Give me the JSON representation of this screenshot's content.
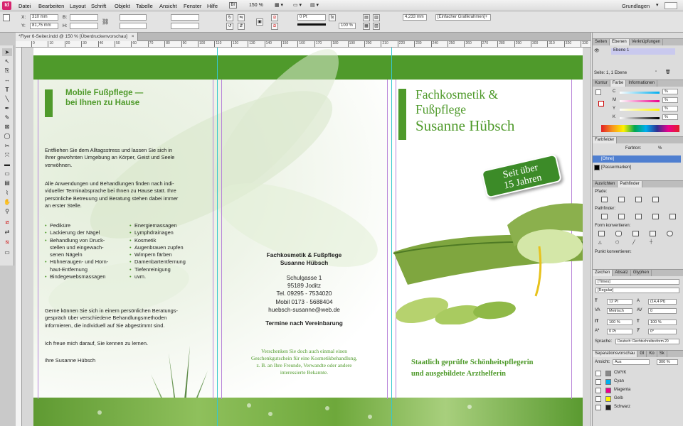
{
  "app": {
    "icon_label": "Id",
    "workspace": "Grundlagen",
    "zoom": "150 %"
  },
  "menu": [
    "Datei",
    "Bearbeiten",
    "Layout",
    "Schrift",
    "Objekt",
    "Tabelle",
    "Ansicht",
    "Fenster",
    "Hilfe"
  ],
  "control": {
    "x_label": "X:",
    "x_value": "310 mm",
    "y_label": "Y:",
    "y_value": "81,75 mm",
    "b_label": "B:",
    "h_label": "H:",
    "stroke_weight": "0 Pt",
    "scale": "100 %",
    "dimension": "4,233 mm",
    "frame_style": "[Einfacher Grafikrahmen]+"
  },
  "tab": {
    "title": "*Flyer 6-Seiter.indd @ 150 % [Überdruckenvorschau]"
  },
  "ruler_ticks": [
    "0",
    "10",
    "20",
    "30",
    "40",
    "50",
    "60",
    "70",
    "80",
    "90",
    "100",
    "110",
    "120",
    "130",
    "140",
    "150",
    "160",
    "170",
    "180",
    "190",
    "200",
    "210",
    "220",
    "230",
    "240",
    "250",
    "260",
    "270",
    "280",
    "290",
    "300",
    "310",
    "320",
    "330"
  ],
  "flyer": {
    "left": {
      "heading_line1": "Mobile Fußpflege —",
      "heading_line2": "bei Ihnen zu Hause",
      "p1": [
        "Entfliehen Sie dem Alltagsstress und lassen Sie sich in",
        "Ihrer gewohnten Umgebung an Körper, Geist und Seele",
        "verwöhnen."
      ],
      "p2": [
        "Alle Anwendungen und Behandlungen finden nach indi-",
        "vidueller Terminabsprache bei Ihnen zu Hause statt. Ihre",
        "persönliche Betreuung und Beratung stehen dabei immer",
        "an erster Stelle."
      ],
      "list_a": [
        "Pediküre",
        "Lackierung der Nägel",
        "Behandlung von Druck-",
        "Hühneraugen- und Horn-",
        "Bindegewebsmassagen"
      ],
      "list_a_cont": {
        "2": "stellen und eingewach-",
        "2b": "senen Nägeln",
        "3": "haut-Entfernung"
      },
      "list_b": [
        "Energiemassagen",
        "Lymphdrainagen",
        "Kosmetik",
        "Augenbrauen zupfen",
        "Wimpern färben",
        "Damenbartentfernung",
        "Tiefenreinigung",
        "uvm."
      ],
      "p3": [
        "Gerne können Sie sich in einem persönlichen Beratungs-",
        "gespräch über verschiedene Behandlungsmethoden",
        "informieren, die individuell auf Sie abgestimmt sind."
      ],
      "p4": "Ich freue mich darauf, Sie kennen zu lernen.",
      "signoff": "Ihre Susanne Hübsch"
    },
    "middle": {
      "name1": "Fachkosmetik & Fußpflege",
      "name2": "Susanne Hübsch",
      "address": [
        "Schulgasse 1",
        "95189 Joditz",
        "Tel. 09295 - 7534020",
        "Mobil 0173 - 5688404",
        "huebsch-susanne@web.de"
      ],
      "appointment": "Termine nach Vereinbarung",
      "voucher": [
        "Verschenken Sie doch auch einmal einen",
        "Geschenkgutschein für eine Kosmetikbehandlung,",
        "z. B. an Ihre Freunde, Verwandte oder andere",
        "interessierte Bekannte."
      ]
    },
    "right": {
      "title1": "Fachkosmetik &",
      "title2": "Fußpflege",
      "title3": "Susanne Hübsch",
      "badge1": "Seit über",
      "badge2": "15 Jahren",
      "footer1": "Staatlich geprüfte Schönheitspflegerin",
      "footer2": "und ausgebildete Arzthelferin"
    },
    "colors": {
      "green": "#4f9a2b",
      "light_green": "#8fc05c"
    }
  },
  "panels": {
    "layers": {
      "tabs": [
        "Seiten",
        "Ebenen",
        "Verknüpfungen"
      ],
      "layer": "Ebene 1",
      "status": "Seite: 1, 1 Ebene"
    },
    "color": {
      "tabs": [
        "Kontur",
        "Farbe",
        "Informationen"
      ],
      "rows": [
        "C",
        "M",
        "Y",
        "K"
      ],
      "unit": "%"
    },
    "swatches": {
      "title": "Farbfelder",
      "tint_label": "Farbton:",
      "tint_unit": "%",
      "items": [
        "[Ohne]",
        "[Passermarken]"
      ]
    },
    "pathfinder": {
      "tabs": [
        "Ausrichten",
        "Pathfinder"
      ],
      "paths_label": "Pfade:",
      "pathfinder_label": "Pathfinder:",
      "convert_shape": "Form konvertieren:",
      "convert_point": "Punkt konvertieren:"
    },
    "character": {
      "tabs": [
        "Zeichen",
        "Absatz",
        "Glyphen"
      ],
      "font": "[Times]",
      "style": "[Regular]",
      "size": "12 Pt",
      "leading": "(14,4 Pt)",
      "kerning": "Metrisch",
      "tracking": "0",
      "vscale": "100 %",
      "hscale": "100 %",
      "baseline": "0 Pt",
      "skew": "0°",
      "language_label": "Sprache:",
      "language": "Deutsch: Rechtschreibreform 20"
    },
    "separations": {
      "tabs": [
        "Separationsvorschau",
        "Gl",
        "Ko",
        "Sk"
      ],
      "view_label": "Ansicht:",
      "view": "Aus",
      "zoom": "300 %",
      "inks": [
        "CMYK",
        "Cyan",
        "Magenta",
        "Gelb",
        "Schwarz"
      ],
      "ink_colors": [
        "#888888",
        "#00aeef",
        "#ec008c",
        "#fff200",
        "#231f20"
      ]
    }
  }
}
